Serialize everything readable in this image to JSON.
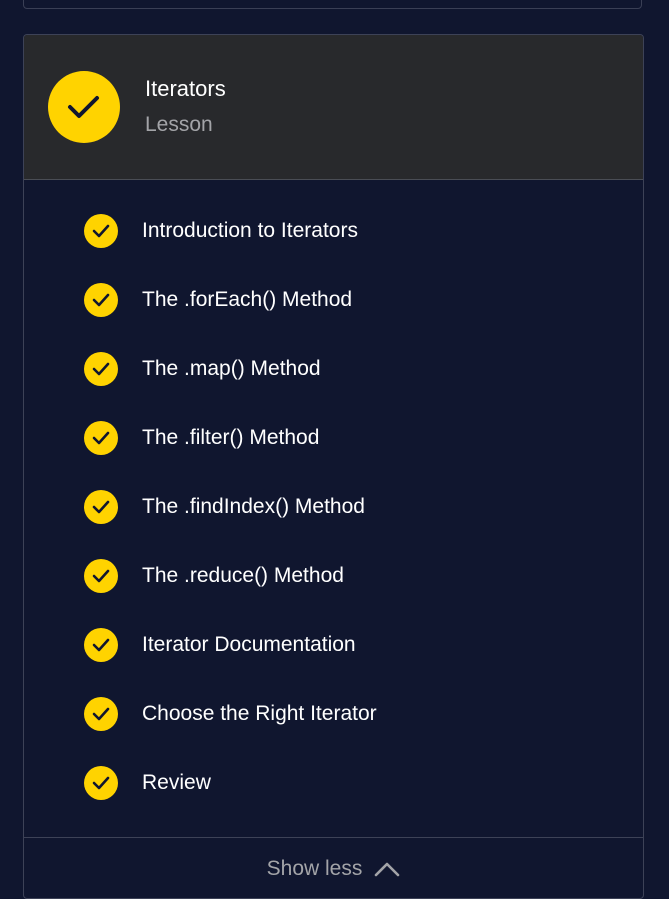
{
  "lesson": {
    "title": "Iterators",
    "type": "Lesson",
    "status_icon": "check-circle-icon",
    "accent_color": "#ffd300"
  },
  "items": [
    {
      "label": "Introduction to Iterators",
      "status": "complete"
    },
    {
      "label": "The .forEach() Method",
      "status": "complete"
    },
    {
      "label": "The .map() Method",
      "status": "complete"
    },
    {
      "label": "The .filter() Method",
      "status": "complete"
    },
    {
      "label": "The .findIndex() Method",
      "status": "complete"
    },
    {
      "label": "The .reduce() Method",
      "status": "complete"
    },
    {
      "label": "Iterator Documentation",
      "status": "complete"
    },
    {
      "label": "Choose the Right Iterator",
      "status": "complete"
    },
    {
      "label": "Review",
      "status": "complete"
    }
  ],
  "footer": {
    "toggle_label": "Show less",
    "toggle_icon": "chevron-up-icon"
  },
  "colors": {
    "background": "#10162f",
    "header_background": "#28292c",
    "text_primary": "#ffffff",
    "text_muted": "#a3a4a8"
  }
}
